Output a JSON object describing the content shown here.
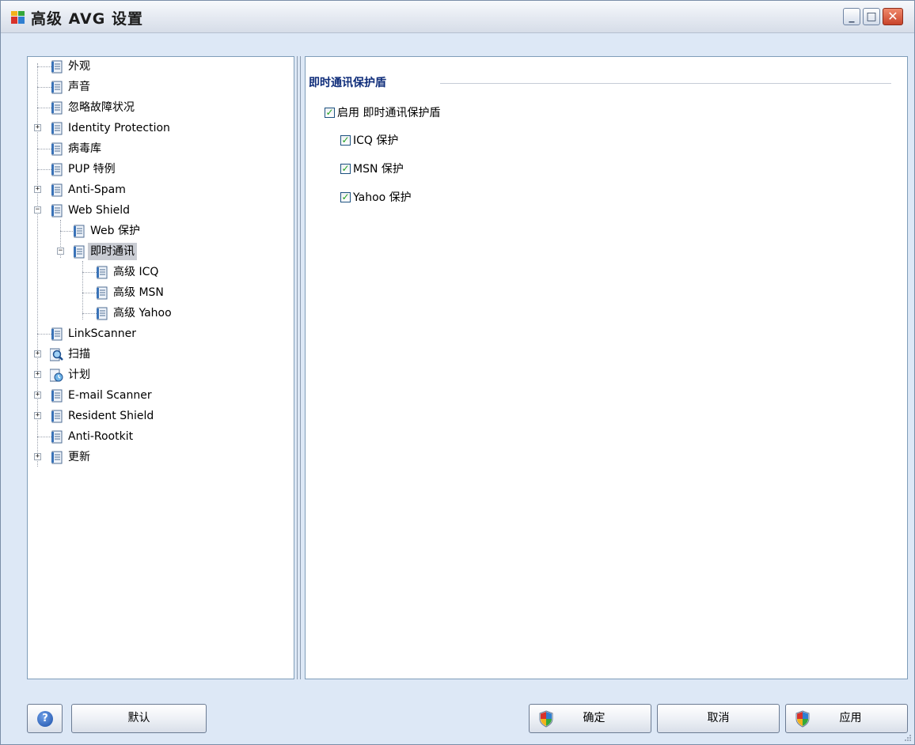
{
  "window": {
    "title": "高级 AVG 设置",
    "controls": {
      "minimize": "_",
      "maximize": "□",
      "close": "✕"
    }
  },
  "tree": {
    "items": [
      {
        "label": "外观",
        "expander": "",
        "icon": "settings-page-icon"
      },
      {
        "label": "声音",
        "expander": "",
        "icon": "settings-page-icon"
      },
      {
        "label": "忽略故障状况",
        "expander": "",
        "icon": "settings-page-icon"
      },
      {
        "label": "Identity Protection",
        "expander": "+",
        "icon": "settings-page-icon"
      },
      {
        "label": "病毒库",
        "expander": "",
        "icon": "settings-page-icon"
      },
      {
        "label": "PUP 特例",
        "expander": "",
        "icon": "settings-page-icon"
      },
      {
        "label": "Anti-Spam",
        "expander": "+",
        "icon": "settings-page-icon"
      },
      {
        "label": "Web Shield",
        "expander": "−",
        "icon": "settings-page-icon"
      },
      {
        "label": "Web 保护",
        "expander": "",
        "icon": "settings-page-icon"
      },
      {
        "label": "即时通讯",
        "expander": "−",
        "icon": "settings-page-icon",
        "selected": true
      },
      {
        "label": "高级 ICQ",
        "expander": "",
        "icon": "settings-page-icon"
      },
      {
        "label": "高级 MSN",
        "expander": "",
        "icon": "settings-page-icon"
      },
      {
        "label": "高级 Yahoo",
        "expander": "",
        "icon": "settings-page-icon"
      },
      {
        "label": "LinkScanner",
        "expander": "",
        "icon": "settings-page-icon"
      },
      {
        "label": "扫描",
        "expander": "+",
        "icon": "magnifier-icon"
      },
      {
        "label": "计划",
        "expander": "+",
        "icon": "schedule-icon"
      },
      {
        "label": "E-mail Scanner",
        "expander": "+",
        "icon": "settings-page-icon"
      },
      {
        "label": "Resident Shield",
        "expander": "+",
        "icon": "settings-page-icon"
      },
      {
        "label": "Anti-Rootkit",
        "expander": "",
        "icon": "settings-page-icon"
      },
      {
        "label": "更新",
        "expander": "+",
        "icon": "settings-page-icon"
      }
    ]
  },
  "main": {
    "section_title": "即时通讯保护盾",
    "options": [
      {
        "label": "启用 即时通讯保护盾",
        "checked": true
      },
      {
        "label": "ICQ 保护",
        "checked": true
      },
      {
        "label": "MSN 保护",
        "checked": true
      },
      {
        "label": "Yahoo 保护",
        "checked": true
      }
    ]
  },
  "buttons": {
    "help": "?",
    "default": "默认",
    "ok": "确定",
    "cancel": "取消",
    "apply": "应用"
  },
  "colors": {
    "window_bg": "#dde8f6",
    "section_title": "#0f2d7a",
    "check": "#21a121",
    "selected_bg": "#c9ccd3"
  }
}
